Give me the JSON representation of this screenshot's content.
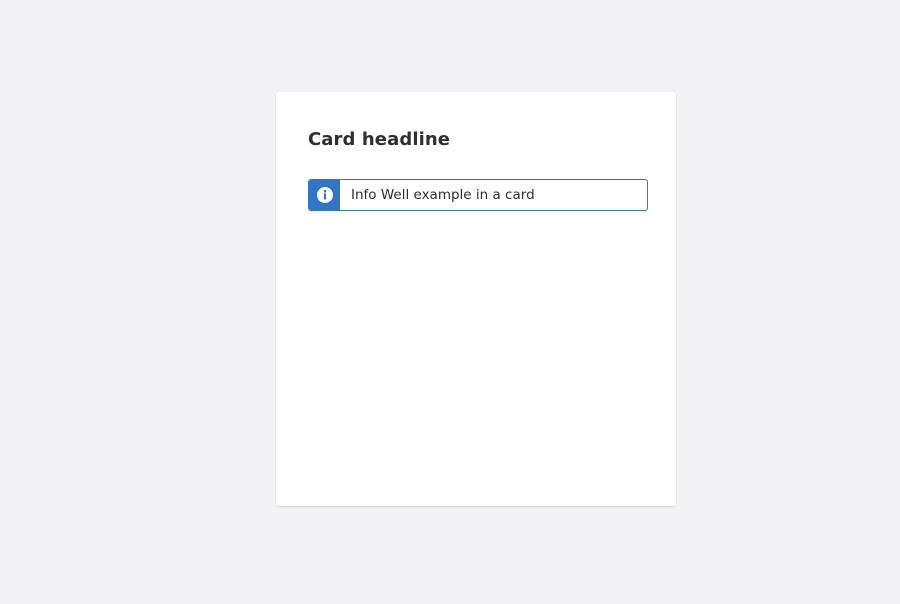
{
  "card": {
    "headline": "Card headline",
    "info_well": {
      "icon": "info-icon",
      "text": "Info Well example in a card",
      "accent_color": "#2f76c9"
    }
  },
  "page": {
    "background_color": "#f3f3f5"
  }
}
